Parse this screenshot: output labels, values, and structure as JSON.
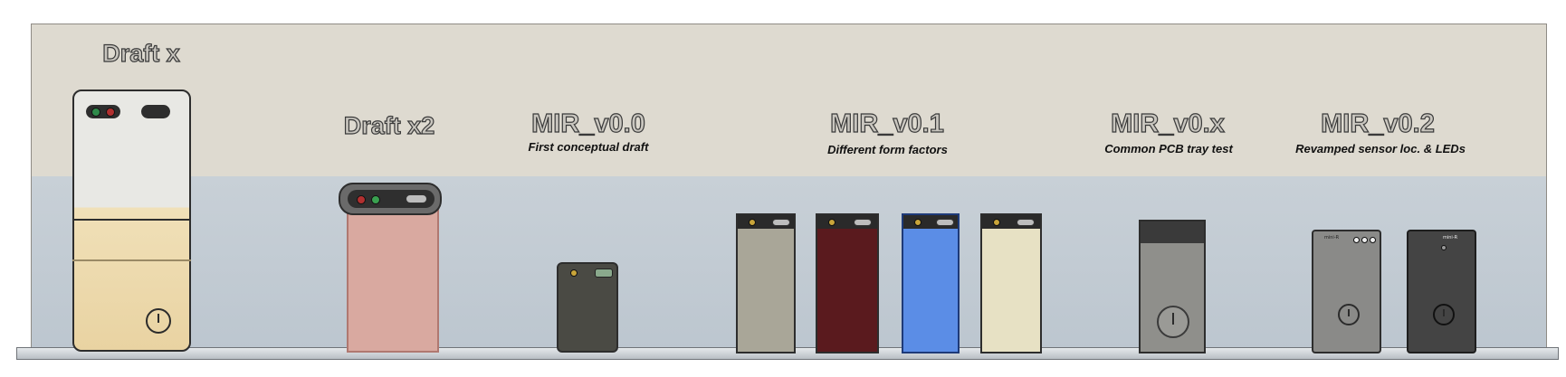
{
  "groups": [
    {
      "title": "Draft x",
      "subtitle": ""
    },
    {
      "title": "Draft x2",
      "subtitle": ""
    },
    {
      "title": "MIR_v0.0",
      "subtitle": "First conceptual draft"
    },
    {
      "title": "MIR_v0.1",
      "subtitle": "Different form factors"
    },
    {
      "title": "MIR_v0.x",
      "subtitle": "Common  PCB tray test"
    },
    {
      "title": "MIR_v0.2",
      "subtitle": "Revamped sensor loc. & LEDs"
    }
  ],
  "icons": {
    "power": "power-icon",
    "led": "led-indicator",
    "usb": "usb-port-icon"
  },
  "colors": {
    "draft_x_body": "#f0e0b8",
    "draft_x2_body": "#d9a9a0",
    "v00_body": "#4a4a44",
    "v01_grey": "#a9a698",
    "v01_red": "#5a1a1e",
    "v01_blue": "#5b8de6",
    "v01_cream": "#e7e1c4",
    "v0x_body": "#8f8f8b",
    "v02_grey": "#8a8a88",
    "v02_dark": "#444444"
  },
  "device_labels": {
    "v02_a": "mini-R",
    "v02_b": "mini-R"
  }
}
